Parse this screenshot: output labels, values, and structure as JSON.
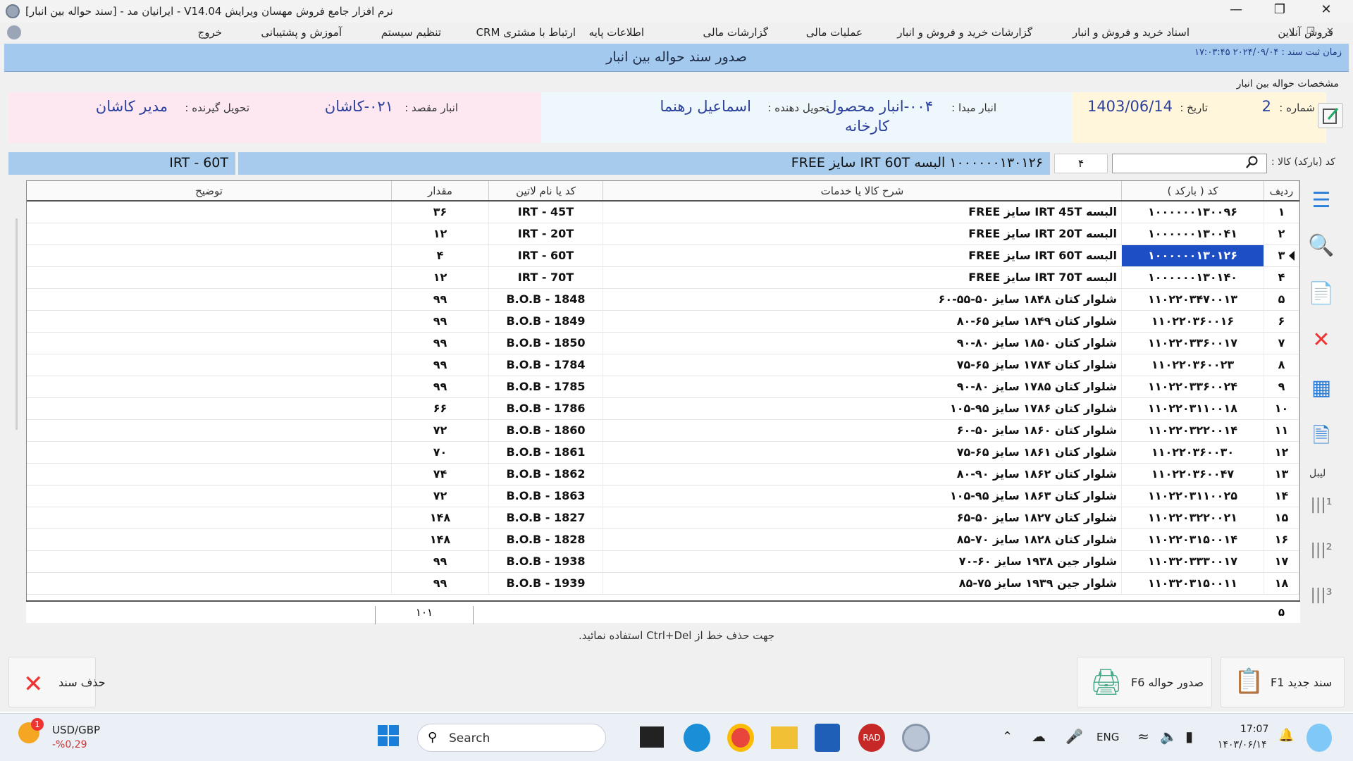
{
  "window": {
    "title": "نرم افزار جامع فروش مهسان ویرایش V14.04 - ایرانیان مد - [سند حواله بین انبار]"
  },
  "menu": [
    "فروش آنلاین",
    "اسناد خرید و فروش و انبار",
    "گزارشات خرید و فروش و انبار",
    "عملیات مالی",
    "گزارشات مالی",
    "اطلاعات پایه",
    "ارتباط با مشتری CRM",
    "تنظیم سیستم",
    "آموزش و پشتیبانی",
    "خروج"
  ],
  "banner": {
    "title": "صدور سند حواله بین انبار",
    "timestamp": "زمان ثبت سند : ۲۰۲۴/۰۹/۰۴ ۱۷:۰۳:۴۵"
  },
  "section_title": "مشخصات حواله بین انبار",
  "header": {
    "number_label": "شماره :",
    "number_value": "2",
    "date_label": "تاریخ :",
    "date_value": "1403/06/14",
    "source_label": "انبار مبدا :",
    "source_value": "۰۰۴-انبار محصول",
    "source_value2": "کارخانه",
    "giver_label": "تحویل دهنده :",
    "giver_value": "اسماعیل رهنما",
    "dest_label": "انبار مقصد :",
    "dest_value": "۰۲۱-کاشان",
    "receiver_label": "تحویل گیرنده :",
    "receiver_value": "مدیر کاشان"
  },
  "search": {
    "label": "کد (بارکد) کالا :",
    "qty": "۴",
    "desc": "۱۰۰۰۰۰۰۱۳۰۱۲۶   البسه  IRT 60T سایز FREE",
    "latin": "IRT - 60T"
  },
  "columns": {
    "row": "ردیف",
    "code": "کد ( بارکد )",
    "desc": "شرح کالا یا خدمات",
    "latin": "کد یا نام لاتین",
    "qty": "مقدار",
    "note": "توضیح"
  },
  "rows": [
    {
      "n": "۱",
      "code": "۱۰۰۰۰۰۰۱۳۰۰۹۶",
      "desc": "البسه  IRT 45T سایز FREE",
      "latin": "IRT - 45T",
      "qty": "۳۶"
    },
    {
      "n": "۲",
      "code": "۱۰۰۰۰۰۰۱۳۰۰۴۱",
      "desc": "البسه  IRT 20T سایز FREE",
      "latin": "IRT - 20T",
      "qty": "۱۲"
    },
    {
      "n": "۳",
      "code": "۱۰۰۰۰۰۰۱۳۰۱۲۶",
      "desc": "البسه  IRT 60T سایز FREE",
      "latin": "IRT - 60T",
      "qty": "۴"
    },
    {
      "n": "۴",
      "code": "۱۰۰۰۰۰۰۱۳۰۱۴۰",
      "desc": "البسه  IRT 70T سایز FREE",
      "latin": "IRT - 70T",
      "qty": "۱۲"
    },
    {
      "n": "۵",
      "code": "۱۱۰۲۲۰۳۴۷۰۰۱۳",
      "desc": "شلوار کتان ۱۸۴۸ سایز ۵۰-۵۵-۶۰",
      "latin": "B.O.B - 1848",
      "qty": "۹۹"
    },
    {
      "n": "۶",
      "code": "۱۱۰۲۲۰۳۶۰۰۱۶",
      "desc": "شلوار کتان ۱۸۴۹ سایز ۶۵-۸۰",
      "latin": "B.O.B - 1849",
      "qty": "۹۹"
    },
    {
      "n": "۷",
      "code": "۱۱۰۲۲۰۳۳۶۰۰۱۷",
      "desc": "شلوار کتان ۱۸۵۰ سایز ۸۰-۹۰",
      "latin": "B.O.B - 1850",
      "qty": "۹۹"
    },
    {
      "n": "۸",
      "code": "۱۱۰۲۲۰۳۶۰۰۲۳",
      "desc": "شلوار کتان ۱۷۸۴ سایز ۶۵-۷۵",
      "latin": "B.O.B - 1784",
      "qty": "۹۹"
    },
    {
      "n": "۹",
      "code": "۱۱۰۲۲۰۳۳۶۰۰۲۴",
      "desc": "شلوار کتان ۱۷۸۵ سایز ۸۰-۹۰",
      "latin": "B.O.B - 1785",
      "qty": "۹۹"
    },
    {
      "n": "۱۰",
      "code": "۱۱۰۲۲۰۳۱۱۰۰۱۸",
      "desc": "شلوار کتان ۱۷۸۶ سایز ۹۵-۱۰۵",
      "latin": "B.O.B - 1786",
      "qty": "۶۶"
    },
    {
      "n": "۱۱",
      "code": "۱۱۰۲۲۰۳۲۲۰۰۱۴",
      "desc": "شلوار کتان ۱۸۶۰ سایز ۵۰-۶۰",
      "latin": "B.O.B - 1860",
      "qty": "۷۲"
    },
    {
      "n": "۱۲",
      "code": "۱۱۰۲۲۰۳۶۰۰۳۰",
      "desc": "شلوار کتان ۱۸۶۱ سایز ۶۵-۷۵",
      "latin": "B.O.B - 1861",
      "qty": "۷۰"
    },
    {
      "n": "۱۳",
      "code": "۱۱۰۲۲۰۳۶۰۰۴۷",
      "desc": "شلوار کتان ۱۸۶۲ سایز ۹۰-۸۰",
      "latin": "B.O.B - 1862",
      "qty": "۷۴"
    },
    {
      "n": "۱۴",
      "code": "۱۱۰۲۲۰۳۱۱۰۰۲۵",
      "desc": "شلوار کتان ۱۸۶۳ سایز ۹۵-۱۰۵",
      "latin": "B.O.B - 1863",
      "qty": "۷۲"
    },
    {
      "n": "۱۵",
      "code": "۱۱۰۲۲۰۳۲۲۰۰۲۱",
      "desc": "شلوار کتان ۱۸۲۷ سایز ۵۰-۶۵",
      "latin": "B.O.B - 1827",
      "qty": "۱۴۸"
    },
    {
      "n": "۱۶",
      "code": "۱۱۰۲۲۰۳۱۵۰۰۱۴",
      "desc": "شلوار کتان ۱۸۲۸ سایز ۷۰-۸۵",
      "latin": "B.O.B - 1828",
      "qty": "۱۴۸"
    },
    {
      "n": "۱۷",
      "code": "۱۱۰۳۲۰۳۳۳۰۰۱۷",
      "desc": "شلوار جین ۱۹۳۸ سایز ۶۰-۷۰",
      "latin": "B.O.B - 1938",
      "qty": "۹۹"
    },
    {
      "n": "۱۸",
      "code": "۱۱۰۳۲۰۳۱۵۰۰۱۱",
      "desc": "شلوار جین ۱۹۳۹ سایز ۷۵-۸۵",
      "latin": "B.O.B - 1939",
      "qty": "۹۹"
    }
  ],
  "footer": {
    "count": "۵",
    "total": "۱۰۱"
  },
  "hint": "جهت حذف خط از Ctrl+Del استفاده نمائید.",
  "side_label": "لیبل",
  "buttons": {
    "delete": "حذف سند",
    "issue": "صدور حواله F6",
    "new": "سند جدید F1"
  },
  "taskbar": {
    "search": "Search",
    "ticker": "USD/GBP",
    "ticker_change": "-%0,29",
    "lang": "ENG",
    "time": "17:07",
    "date": "۱۴۰۳/۰۶/۱۴",
    "badge": "1"
  }
}
